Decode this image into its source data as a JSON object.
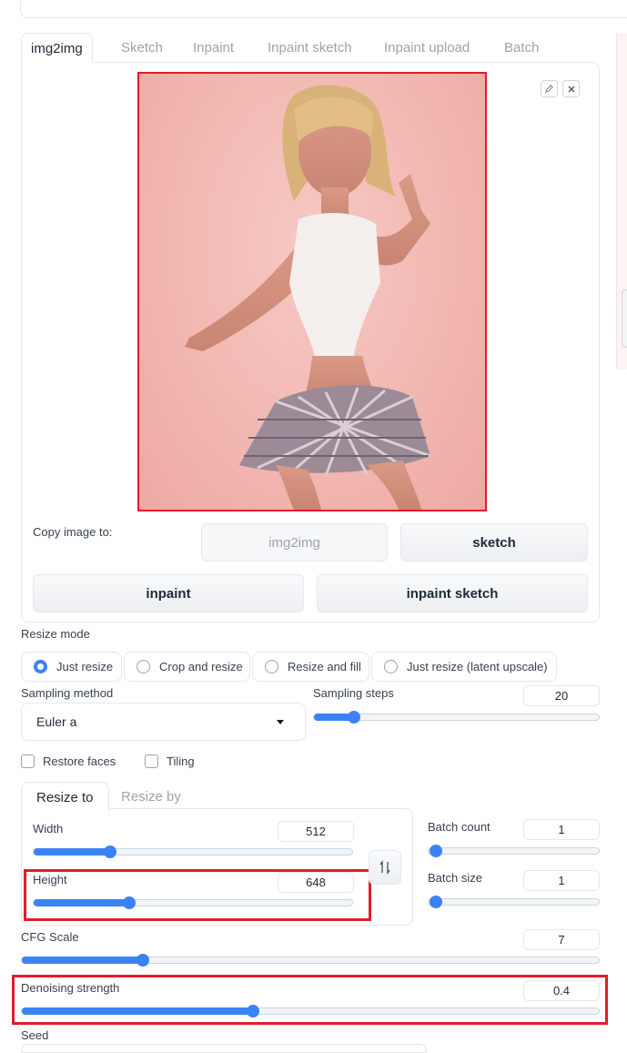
{
  "tabs": [
    "img2img",
    "Sketch",
    "Inpaint",
    "Inpaint sketch",
    "Inpaint upload",
    "Batch"
  ],
  "active_tab": "img2img",
  "copy_image": {
    "label": "Copy image to:",
    "buttons": [
      "img2img",
      "sketch",
      "inpaint",
      "inpaint sketch"
    ]
  },
  "resize_mode": {
    "label": "Resize mode",
    "options": [
      "Just resize",
      "Crop and resize",
      "Resize and fill",
      "Just resize (latent upscale)"
    ],
    "selected": "Just resize"
  },
  "sampling": {
    "method_label": "Sampling method",
    "method_value": "Euler a",
    "steps_label": "Sampling steps",
    "steps_value": "20",
    "steps_fraction": 0.14
  },
  "options": {
    "restore_faces": "Restore faces",
    "tiling": "Tiling"
  },
  "resize_tabs": [
    "Resize to",
    "Resize by"
  ],
  "dimensions": {
    "width_label": "Width",
    "width_value": "512",
    "width_fraction": 0.24,
    "height_label": "Height",
    "height_value": "648",
    "height_fraction": 0.3
  },
  "batch": {
    "count_label": "Batch count",
    "count_value": "1",
    "size_label": "Batch size",
    "size_value": "1"
  },
  "cfg": {
    "label": "CFG Scale",
    "value": "7",
    "fraction": 0.21
  },
  "denoise": {
    "label": "Denoising strength",
    "value": "0.4",
    "fraction": 0.4
  },
  "seed": {
    "label": "Seed"
  },
  "colors": {
    "accent": "#3b82f6",
    "highlight": "#e11d2a"
  }
}
